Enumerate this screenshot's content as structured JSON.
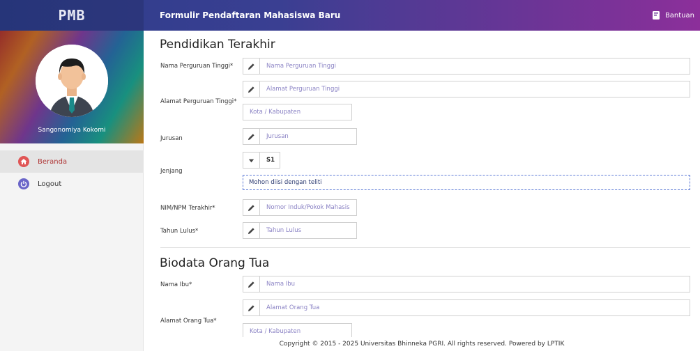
{
  "header": {
    "logo": "PMB",
    "title": "Formulir Pendaftaran Mahasiswa Baru",
    "help_label": "Bantuan",
    "help_icon": "book-icon"
  },
  "sidebar": {
    "username": "Sangonomiya Kokomi",
    "items": [
      {
        "label": "Beranda",
        "icon": "home-icon"
      },
      {
        "label": "Logout",
        "icon": "power-icon"
      }
    ]
  },
  "pendidikan": {
    "title": "Pendidikan Terakhir",
    "nama_pt": {
      "label": "Nama Perguruan Tinggi*",
      "placeholder": "Nama Perguruan Tinggi"
    },
    "alamat_pt": {
      "label": "Alamat Perguruan Tinggi*",
      "placeholder": "Alamat Perguruan Tinggi",
      "kota_placeholder": "Kota / Kabupaten"
    },
    "jurusan": {
      "label": "Jurusan",
      "placeholder": "Jurusan"
    },
    "jenjang": {
      "label": "Jenjang",
      "value": "S1",
      "note": "Mohon diisi dengan teliti"
    },
    "nim": {
      "label": "NIM/NPM Terakhir*",
      "placeholder": "Nomor Induk/Pokok Mahasis"
    },
    "tahun": {
      "label": "Tahun Lulus*",
      "placeholder": "Tahun Lulus"
    }
  },
  "orangtua": {
    "title": "Biodata Orang Tua",
    "nama_ibu": {
      "label": "Nama Ibu*",
      "placeholder": "Nama Ibu"
    },
    "alamat": {
      "label": "Alamat Orang Tua*",
      "placeholder": "Alamat Orang Tua",
      "kota_placeholder": "Kota / Kabupaten"
    }
  },
  "footer": {
    "text": "Copyright © 2015 - 2025 Universitas Bhinneka PGRI. All rights reserved. Powered by LPTIK"
  },
  "colors": {
    "header_start": "#2c3d8a",
    "header_end": "#8c2f9a",
    "placeholder": "#8a82c4",
    "active_menu": "#b03a3a",
    "note_border": "#5c7ad6"
  }
}
